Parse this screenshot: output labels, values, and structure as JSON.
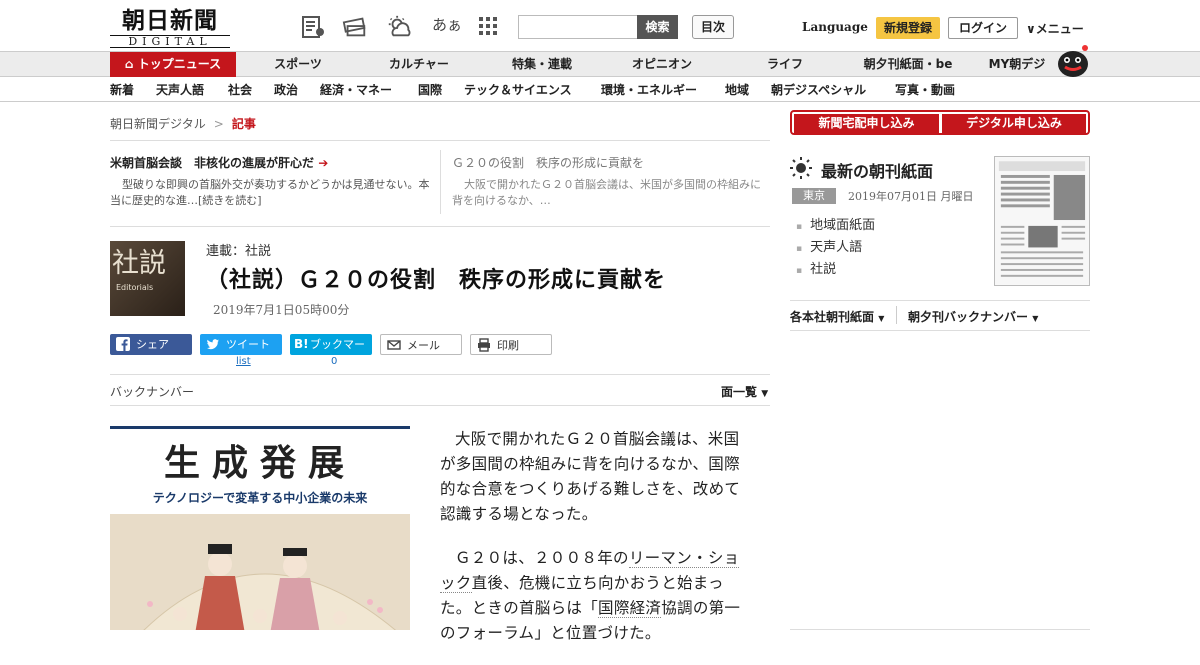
{
  "header": {
    "logo_main": "朝日新聞",
    "logo_sub": "DIGITAL",
    "search_button": "検索",
    "toc_button": "目次",
    "language": "Language",
    "register": "新規登録",
    "login": "ログイン",
    "menu": "メニュー",
    "font_toggle": "あぁ"
  },
  "nav1": [
    "トップニュース",
    "スポーツ",
    "カルチャー",
    "特集・連載",
    "オピニオン",
    "ライフ",
    "朝夕刊紙面・be",
    "MY朝デジ"
  ],
  "nav2": [
    "新着",
    "天声人語",
    "社会",
    "政治",
    "経済・マネー",
    "国際",
    "テック＆サイエンス",
    "環境・エネルギー",
    "地域",
    "朝デジスペシャル",
    "写真・動画"
  ],
  "breadcrumb": {
    "root": "朝日新聞デジタル",
    "sep": ">",
    "current": "記事"
  },
  "related": [
    {
      "title": "米朝首脳会談　非核化の進展が肝心だ",
      "desc": "型破りな即興の首脳外交が奏功するかどうかは見通せない。本当に歴史的な進…[続きを読む]"
    },
    {
      "title": "Ｇ２０の役割　秩序の形成に貢献を",
      "desc": "大阪で開かれたＧ２０首脳会議は、米国が多国間の枠組みに背を向けるなか、…"
    }
  ],
  "article": {
    "thumb_title": "社説",
    "thumb_sub": "Editorials",
    "series": "連載：社説",
    "title": "（社説）Ｇ２０の役割　秩序の形成に貢献を",
    "date": "2019年7月1日05時00分",
    "p1": "大阪で開かれたＧ２０首脳会議は、米国が多国間の枠組みに背を向けるなか、国際的な合意をつくりあげる難しさを、改めて認識する場となった。",
    "p2_a": "Ｇ２０は、２００８年の",
    "p2_link1": "リーマン・ショック",
    "p2_b": "直後、危機に立ち向かおうと始まった。ときの首脳らは「",
    "p2_link2": "国際経済",
    "p2_c": "協調の第一のフォーラム」と位置づけた。"
  },
  "share": {
    "facebook": "シェア",
    "twitter": "ツイート",
    "hatena": "ブックマーク",
    "mail": "メール",
    "print": "印刷",
    "twitter_count": "list",
    "hatena_count": "0"
  },
  "backnumber": "バックナンバー",
  "pagelist": "面一覧",
  "ad": {
    "title": "生成発展",
    "subtitle": "テクノロジーで変革する中小企業の未来"
  },
  "right": {
    "btn_delivery": "新聞宅配申し込み",
    "btn_digital": "デジタル申し込み",
    "paper_heading": "最新の朝刊紙面",
    "city": "東京",
    "paper_date": "2019年07月01日 月曜日",
    "links": [
      "地域面紙面",
      "天声人語",
      "社説"
    ],
    "select1": "各本社朝刊紙面",
    "select2": "朝夕刊バックナンバー"
  },
  "colors": {
    "brand_red": "#c4161c",
    "register_yellow": "#f5c542",
    "facebook": "#3b5998",
    "twitter": "#1da1f2",
    "hatena": "#00a4de"
  }
}
